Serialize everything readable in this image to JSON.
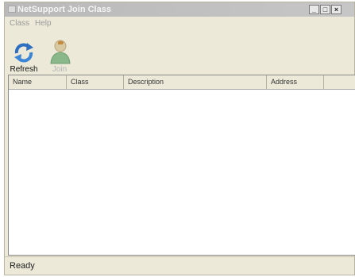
{
  "window": {
    "title": "NetSupport Join Class"
  },
  "menu": [
    {
      "label": "Class"
    },
    {
      "label": "Help"
    }
  ],
  "toolbar": {
    "refresh_label": "Refresh",
    "join_label": "Join"
  },
  "table": {
    "columns": [
      "Name",
      "Class",
      "Description",
      "Address",
      ""
    ],
    "rows": []
  },
  "status": {
    "text": "Ready"
  },
  "icons": {
    "refresh": "refresh-arrows-icon",
    "join": "user-person-icon"
  }
}
